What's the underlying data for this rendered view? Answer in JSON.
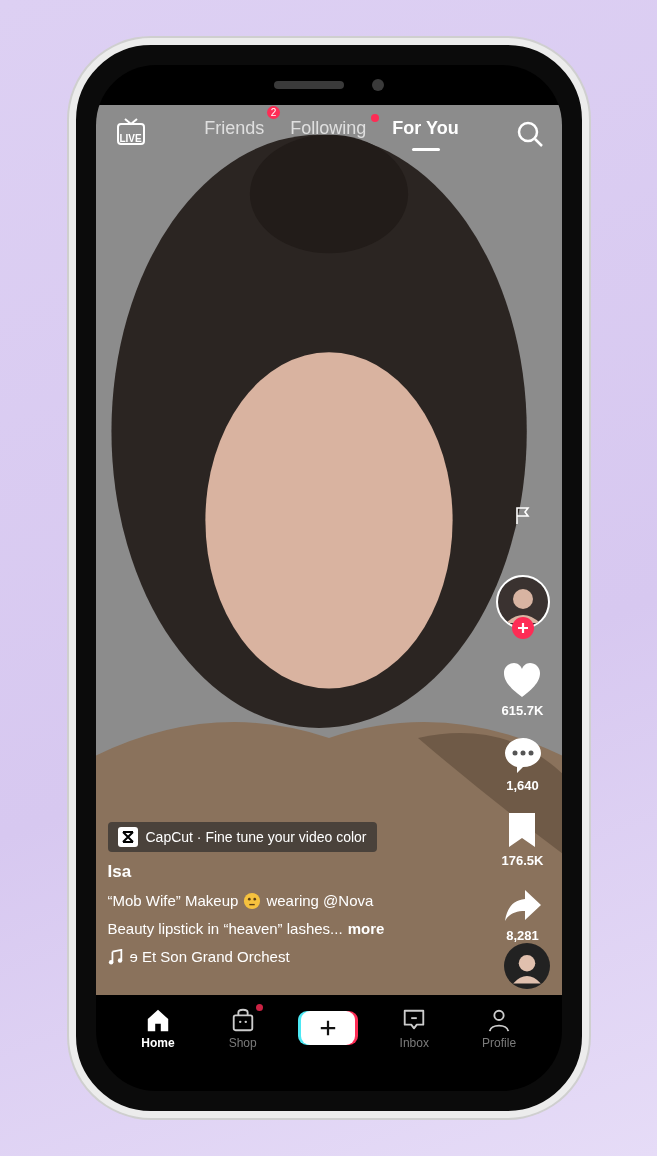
{
  "top_bar": {
    "live_label": "LIVE",
    "tabs": [
      {
        "label": "Friends",
        "selected": false,
        "badge": "2"
      },
      {
        "label": "Following",
        "selected": false,
        "dot": true
      },
      {
        "label": "For You",
        "selected": true,
        "dot": false
      }
    ]
  },
  "rail": {
    "follow": true,
    "actions": [
      {
        "kind": "like",
        "count": "615.7K"
      },
      {
        "kind": "comment",
        "count": "1,640"
      },
      {
        "kind": "save",
        "count": "176.5K"
      },
      {
        "kind": "share",
        "count": "8,281"
      }
    ]
  },
  "capcut_banner": "CapCut · Fine tune your video color",
  "author": "Isa",
  "description": {
    "before_emoji": "“Mob Wife” Makeup",
    "after_emoji": "wearing @Nova",
    "line_2": "Beauty lipstick in “heaven” lashes...",
    "more": "more"
  },
  "music": "ɘ Et Son Grand Orchest",
  "nav": [
    {
      "kind": "home",
      "label": "Home",
      "selected": true,
      "dot": false
    },
    {
      "kind": "shop",
      "label": "Shop",
      "selected": false,
      "dot": true
    },
    {
      "kind": "create"
    },
    {
      "kind": "inbox",
      "label": "Inbox",
      "selected": false,
      "dot": false
    },
    {
      "kind": "profile",
      "label": "Profile",
      "selected": false,
      "dot": false
    }
  ]
}
